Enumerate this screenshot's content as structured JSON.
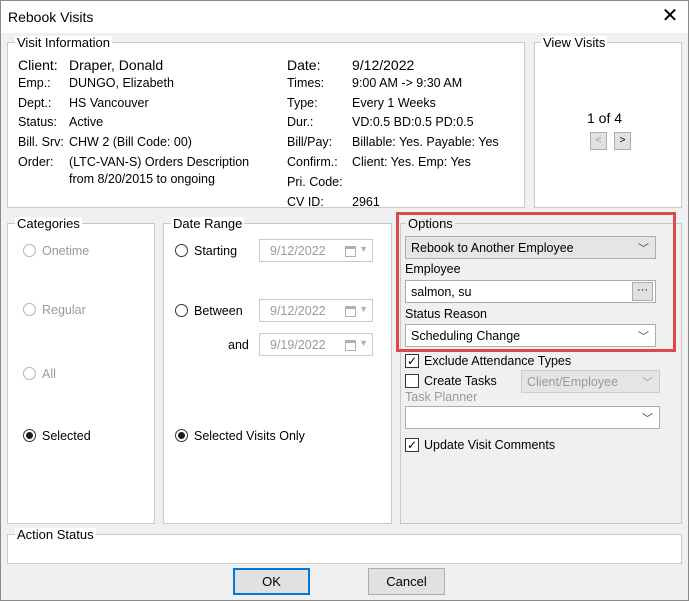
{
  "window": {
    "title": "Rebook Visits",
    "close_glyph": "✕"
  },
  "visit_info": {
    "legend": "Visit Information",
    "client_label": "Client:",
    "client_value": "Draper, Donald",
    "emp_label": "Emp.:",
    "emp_value": "DUNGO, Elizabeth",
    "dept_label": "Dept.:",
    "dept_value": "HS Vancouver",
    "status_label": "Status:",
    "status_value": "Active",
    "billsrv_label": "Bill. Srv:",
    "billsrv_value": "CHW 2 (Bill Code: 00)",
    "order_label": "Order:",
    "order_value_1": "(LTC-VAN-S) Orders Description",
    "order_value_2": "from 8/20/2015 to ongoing",
    "date_label": "Date:",
    "date_value": "9/12/2022",
    "times_label": "Times:",
    "times_value": "9:00 AM -> 9:30 AM",
    "type_label": "Type:",
    "type_value": "Every 1 Weeks",
    "dur_label": "Dur.:",
    "dur_value": "VD:0.5  BD:0.5  PD:0.5",
    "billpay_label": "Bill/Pay:",
    "billpay_value": "Billable: Yes. Payable: Yes",
    "confirm_label": "Confirm.:",
    "confirm_value": "Client: Yes. Emp: Yes",
    "pricode_label": "Pri. Code:",
    "pricode_value": "",
    "cvid_label": "CV ID:",
    "cvid_value": "2961"
  },
  "view_visits": {
    "legend": "View Visits",
    "counter": "1 of 4",
    "prev": "<",
    "next": ">"
  },
  "categories": {
    "legend": "Categories",
    "onetime": "Onetime",
    "regular": "Regular",
    "all": "All",
    "selected": "Selected"
  },
  "date_range": {
    "legend": "Date Range",
    "starting": "Starting",
    "between": "Between",
    "and": "and",
    "selected_only": "Selected Visits Only",
    "starting_date": "9/12/2022",
    "between_date": "9/12/2022",
    "and_date": "9/19/2022"
  },
  "options": {
    "legend": "Options",
    "action_value": "Rebook to Another Employee",
    "employee_label": "Employee",
    "employee_value": "salmon, su",
    "browse_label": "···",
    "status_reason_label": "Status Reason",
    "status_reason_value": "Scheduling Change",
    "exclude_attendance": "Exclude Attendance Types",
    "create_tasks": "Create Tasks",
    "create_tasks_value": "Client/Employee",
    "task_planner_label": "Task Planner",
    "task_planner_value": "",
    "update_comments": "Update Visit Comments",
    "highlight_color": "#e0474c"
  },
  "action_status": {
    "legend": "Action Status"
  },
  "footer": {
    "ok": "OK",
    "cancel": "Cancel"
  }
}
